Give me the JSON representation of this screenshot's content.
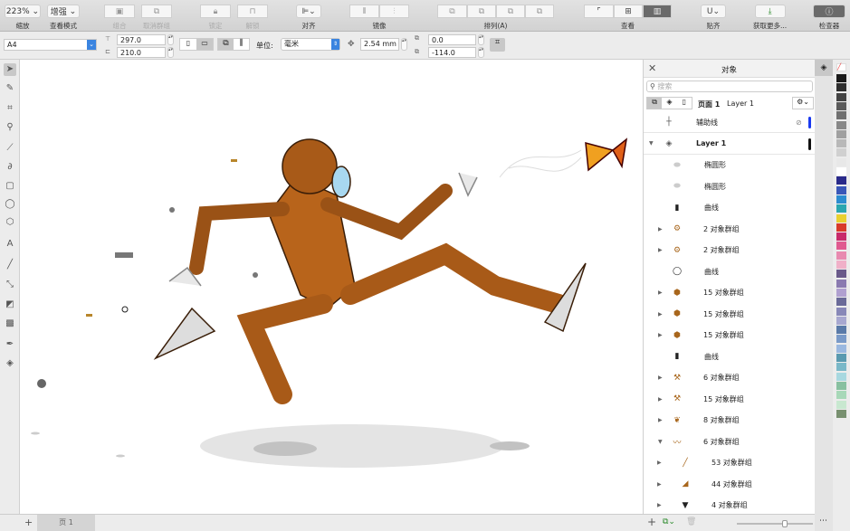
{
  "toolbar": {
    "zoom": {
      "value": "223%",
      "label": "缩放"
    },
    "view_mode": {
      "value": "增强",
      "label": "查看模式"
    },
    "group_label": "组合",
    "ungroup_label": "取消群组",
    "lock_label": "锁定",
    "unlock_label": "解锁",
    "align_label": "对齐",
    "mirror_label": "镜像",
    "arrange_label": "排列(A)",
    "view_label": "查看",
    "snap_label": "贴齐",
    "get_more_label": "获取更多...",
    "inspector_label": "检查器"
  },
  "propbar": {
    "page_size": "A4",
    "width": "297.0",
    "height": "210.0",
    "units_label": "单位:",
    "units": "毫米",
    "nudge": "2.54 mm",
    "dup_x": "0.0",
    "dup_y": "-114.0"
  },
  "panel": {
    "title": "对象",
    "search_placeholder": "搜索",
    "page_label": "页面 1",
    "layer_label": "Layer 1",
    "rows": [
      {
        "name": "辅助线",
        "icon": "guides-icon",
        "level": 0,
        "expand": ""
      },
      {
        "name": "Layer 1",
        "icon": "layers-icon",
        "level": 0,
        "expand": "open",
        "bold": true
      },
      {
        "name": "椭圆形",
        "icon": "ellipse-icon",
        "level": 1,
        "expand": ""
      },
      {
        "name": "椭圆形",
        "icon": "ellipse-icon",
        "level": 1,
        "expand": ""
      },
      {
        "name": "曲线",
        "icon": "curve-icon",
        "level": 1,
        "expand": ""
      },
      {
        "name": "2 对象群组",
        "icon": "bolt-icon",
        "level": 1,
        "expand": "closed"
      },
      {
        "name": "2 对象群组",
        "icon": "bolt-icon",
        "level": 1,
        "expand": "closed"
      },
      {
        "name": "曲线",
        "icon": "ring-icon",
        "level": 1,
        "expand": ""
      },
      {
        "name": "15 对象群组",
        "icon": "nut-icon",
        "level": 1,
        "expand": "closed"
      },
      {
        "name": "15 对象群组",
        "icon": "nut-icon",
        "level": 1,
        "expand": "closed"
      },
      {
        "name": "15 对象群组",
        "icon": "nut-icon",
        "level": 1,
        "expand": "closed"
      },
      {
        "name": "曲线",
        "icon": "curve-icon",
        "level": 1,
        "expand": ""
      },
      {
        "name": "6 对象群组",
        "icon": "screw-icon",
        "level": 1,
        "expand": "closed"
      },
      {
        "name": "15 对象群组",
        "icon": "screw-icon",
        "level": 1,
        "expand": "closed"
      },
      {
        "name": "8 对象群组",
        "icon": "butterfly-icon",
        "level": 1,
        "expand": "closed"
      },
      {
        "name": "6 对象群组",
        "icon": "robot-part-icon",
        "level": 1,
        "expand": "open"
      },
      {
        "name": "53 对象群组",
        "icon": "arm-icon",
        "level": 2,
        "expand": "closed"
      },
      {
        "name": "44 对象群组",
        "icon": "leg-icon",
        "level": 2,
        "expand": "closed"
      },
      {
        "name": "4 对象群组",
        "icon": "shoe-icon",
        "level": 2,
        "expand": "closed"
      }
    ]
  },
  "page_tab": "页 1",
  "colors": {
    "accent": "#2b6cd8",
    "robot": "#b8641b",
    "robot_dark": "#6b3a10",
    "palette": [
      "#1a1a1a",
      "#2e2e2e",
      "#444",
      "#5a5a5a",
      "#707070",
      "#888",
      "#a0a0a0",
      "#b8b8b8",
      "#d0d0d0",
      "#e8e8e8",
      "#ffffff",
      "#2a2a8a",
      "#3a57b8",
      "#2c8cd0",
      "#2aa6b0",
      "#e8d030",
      "#d83a2a",
      "#c82a6a",
      "#e05a90",
      "#e88ab0",
      "#f0b0c8",
      "#6a5a8a",
      "#8a7ab0",
      "#b0a0d0",
      "#6a6a98",
      "#8888b8",
      "#a8a8d0",
      "#5a7aa8",
      "#7a9ac8",
      "#9ab8e0",
      "#5a9ab0",
      "#7ab8c8",
      "#a8d8e0",
      "#88c0a0",
      "#a8d8b8",
      "#c8e8d0",
      "#789070"
    ]
  }
}
